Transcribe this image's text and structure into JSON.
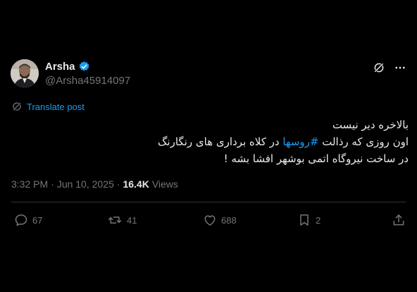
{
  "author": {
    "display_name": "Arsha",
    "handle": "@Arsha45914097",
    "verified": true,
    "verified_color": "#1d9bf0"
  },
  "translate": {
    "label": "Translate post"
  },
  "post": {
    "line1": "بالاخره دیر نیست",
    "line2_before": "اون روزی که رذالت ",
    "hashtag": "#روسها",
    "line2_after": " در کلاه برداری های رنگارنگ",
    "line3": "در ساخت نیروگاه اتمی بوشهر افشا بشه !"
  },
  "meta": {
    "time": "3:32 PM",
    "separator": "·",
    "date": "Jun 10, 2025",
    "views_count": "16.4K",
    "views_label": "Views"
  },
  "actions": {
    "replies": "67",
    "reposts": "41",
    "likes": "688",
    "bookmarks": "2"
  },
  "colors": {
    "background": "#000000",
    "text": "#e7e9ea",
    "muted": "#71767b",
    "accent": "#1d9bf0"
  }
}
